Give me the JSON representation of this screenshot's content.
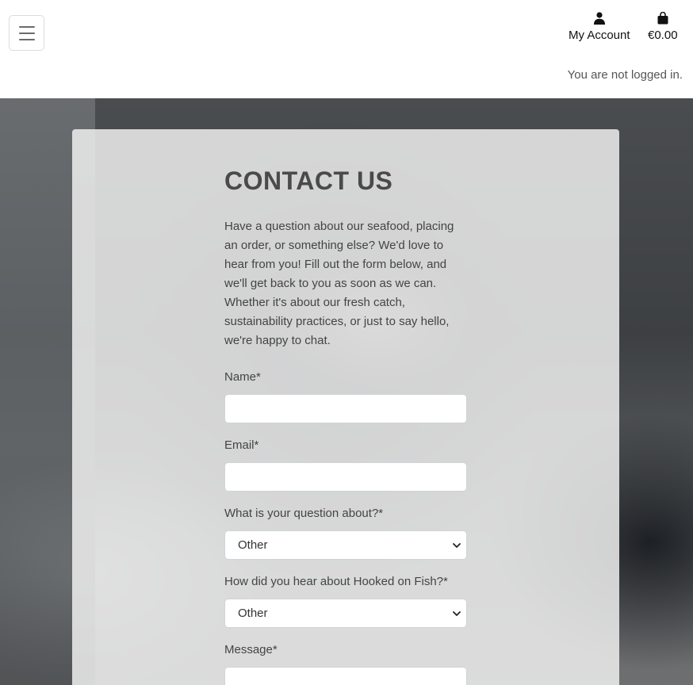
{
  "header": {
    "account_label": "My Account",
    "bag_total": "€0.00",
    "login_status": "You are not logged in."
  },
  "contact": {
    "title": "CONTACT US",
    "intro": "Have a question about our seafood, placing an order, or something else? We'd love to hear from you! Fill out the form below, and we'll get back to you as soon as we can. Whether it's about our fresh catch, sustainability practices, or just to say hello, we're happy to chat.",
    "name_label": "Name*",
    "email_label": "Email*",
    "topic_label": "What is your question about?*",
    "topic_value": "Other",
    "source_label": "How did you hear about Hooked on Fish?*",
    "source_value": "Other",
    "message_label": "Message*"
  },
  "icons": {
    "menu": "hamburger-icon",
    "account": "user-icon",
    "bag": "shopping-bag-icon",
    "dropdown": "chevron-down-icon"
  }
}
